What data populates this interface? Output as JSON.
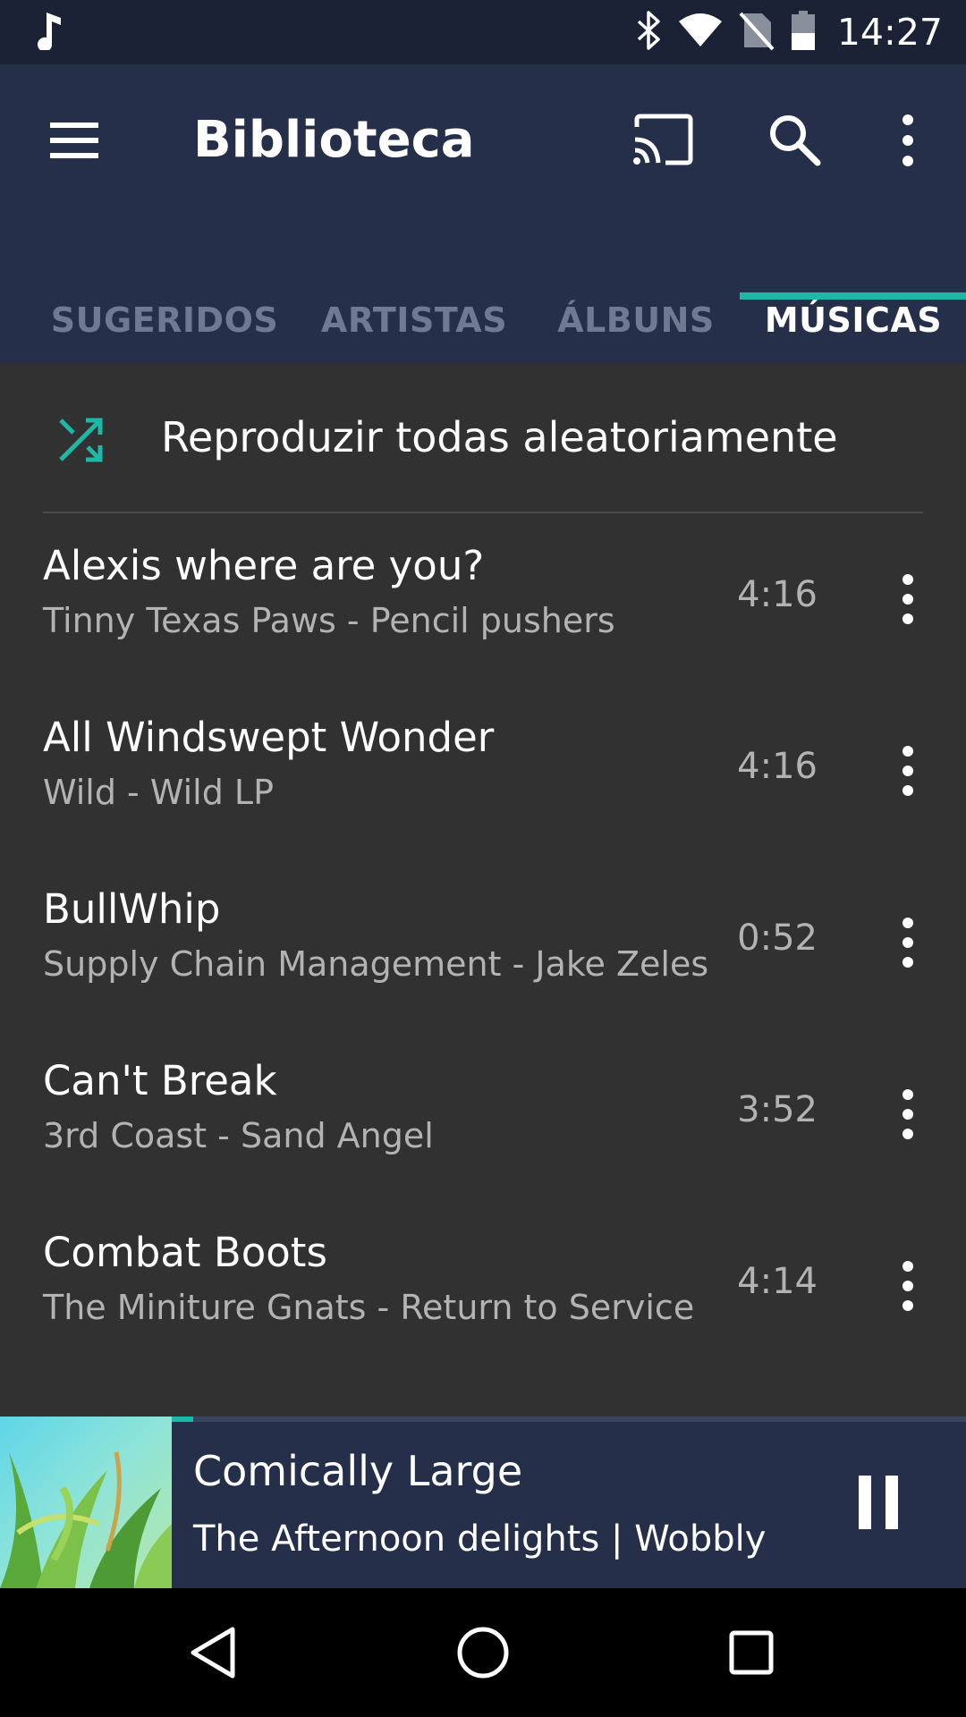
{
  "status_bar": {
    "time": "14:27",
    "icons": [
      "music-note-icon",
      "bluetooth-icon",
      "wifi-icon",
      "no-sim-icon",
      "battery-icon"
    ]
  },
  "toolbar": {
    "title": "Biblioteca",
    "icons": [
      "menu-icon",
      "cast-icon",
      "search-icon",
      "more-vert-icon"
    ]
  },
  "tabs": [
    {
      "label": "SUGERIDOS",
      "active": false
    },
    {
      "label": "ARTISTAS",
      "active": false
    },
    {
      "label": "ÁLBUNS",
      "active": false
    },
    {
      "label": "MÚSICAS",
      "active": true
    }
  ],
  "shuffle": {
    "label": "Reproduzir todas aleatoriamente",
    "icon": "shuffle-icon"
  },
  "songs": [
    {
      "title": "Alexis where are you?",
      "subtitle": "Tinny Texas Paws - Pencil pushers",
      "duration": "4:16"
    },
    {
      "title": "All Windswept Wonder",
      "subtitle": "Wild - Wild LP",
      "duration": "4:16"
    },
    {
      "title": "BullWhip",
      "subtitle": "Supply Chain Management - Jake Zeles",
      "duration": "0:52"
    },
    {
      "title": "Can't Break",
      "subtitle": "3rd Coast - Sand Angel",
      "duration": "3:52"
    },
    {
      "title": "Combat Boots",
      "subtitle": "The Miniture Gnats - Return to Service",
      "duration": "4:14"
    }
  ],
  "now_playing": {
    "title": "Comically Large",
    "subtitle": "The Afternoon delights | Wobbly",
    "progress": 0.2,
    "icon": "pause-icon"
  },
  "nav_bar": {
    "icons": [
      "back-icon",
      "home-icon",
      "recents-icon"
    ]
  },
  "colors": {
    "accent": "#1db9a8",
    "app_bar": "#252f4a",
    "status_bar": "#1b2236",
    "background": "#313131"
  }
}
